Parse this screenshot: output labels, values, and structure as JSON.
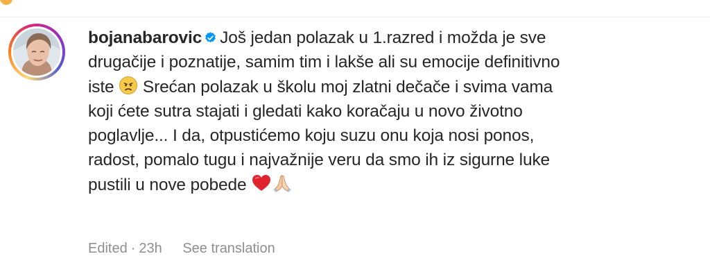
{
  "comment": {
    "username": "bojanabarovic",
    "verified_badge_icon": "verified-badge-icon",
    "lines": [
      "Još jedan polazak u 1.razred i možda je sve",
      "drugačije i poznatije, samim tim i lakše ali su emocije definitivno",
      "iste",
      "Srećan polazak u školu moj zlatni dečače i svima vama",
      "koji ćete sutra stajati i gledati kako koračaju u novo životno",
      "poglavlje... I da, otpustićemo koju suzu onu koja nosi ponos,",
      "radost, pomalo tugu i najvažnije veru da smo ih iz sigurne luke",
      "pustili u nove pobede"
    ],
    "emojis": {
      "sad_face": "sad-face-emoji",
      "heart": "red-heart-emoji",
      "praying_hands": "folded-hands-emoji"
    }
  },
  "meta": {
    "edited": "Edited",
    "separator": "·",
    "time": "23h",
    "see_translation": "See translation"
  },
  "colors": {
    "text": "#262626",
    "muted": "#8e8e8e",
    "verified": "#0095f6",
    "heart": "#e0242f"
  }
}
